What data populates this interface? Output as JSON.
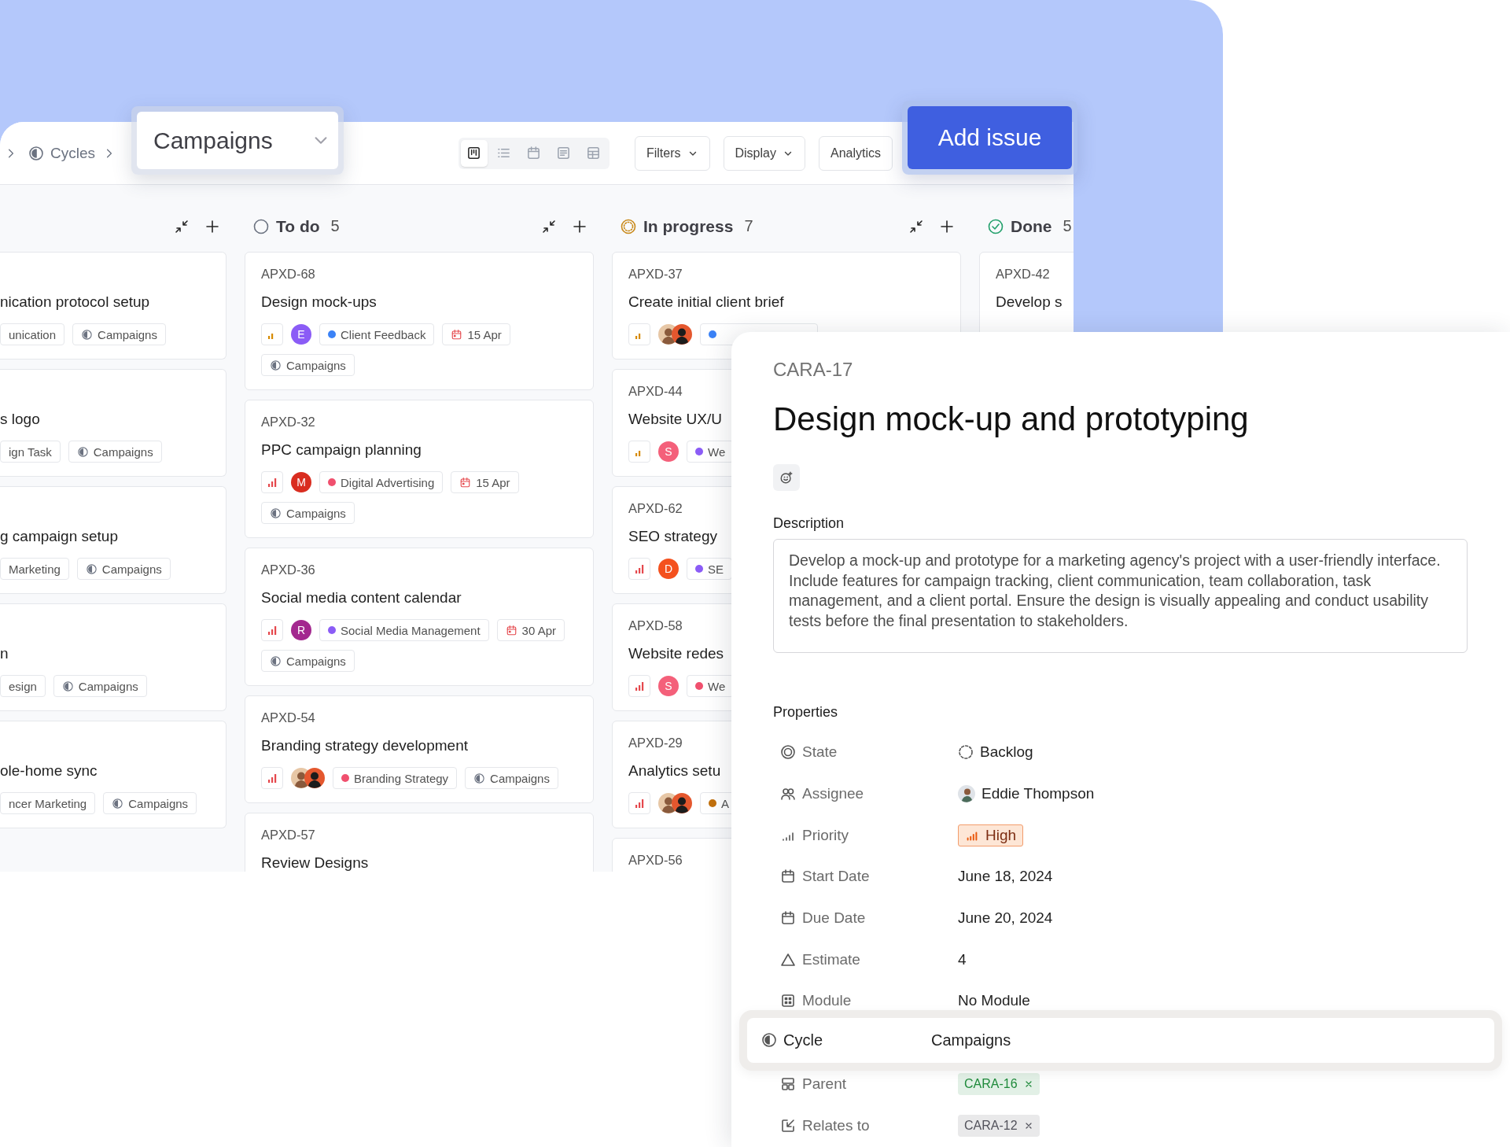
{
  "breadcrumb": {
    "parent": "Cycles",
    "current": "Campaigns"
  },
  "views": [
    {
      "kind": "board",
      "selected": true
    },
    {
      "kind": "list",
      "selected": false
    },
    {
      "kind": "calendar",
      "selected": false
    },
    {
      "kind": "page",
      "selected": false
    },
    {
      "kind": "table",
      "selected": false
    }
  ],
  "toolbar": {
    "filters": "Filters",
    "display": "Display",
    "analytics": "Analytics",
    "add_issue": "Add issue"
  },
  "columns": [
    {
      "cards": [
        {
          "title": "nication protocol setup",
          "label": {
            "text": "unication"
          },
          "cycle": "Campaigns"
        },
        {
          "title": "s logo",
          "label": {
            "text": "ign Task"
          },
          "cycle": "Campaigns"
        },
        {
          "title": "g campaign setup",
          "label": {
            "text": "Marketing"
          },
          "cycle": "Campaigns"
        },
        {
          "title": "n",
          "label": {
            "text": "esign"
          },
          "cycle": "Campaigns"
        },
        {
          "title": "ole-home sync",
          "label": {
            "text": "ncer Marketing"
          },
          "cycle": "Campaigns"
        }
      ]
    },
    {
      "kind": "todo",
      "title": "To do",
      "count": "5",
      "cards": [
        {
          "id": "APXD-68",
          "title": "Design mock-ups",
          "priority": {
            "kind": "medium"
          },
          "avatars": [
            {
              "kind": "letter",
              "letter": "E",
              "color": "#8b5cf6"
            }
          ],
          "label": {
            "text": "Client Feedback",
            "color": "#3b82f6"
          },
          "date": "15 Apr",
          "cycle": "Campaigns"
        },
        {
          "id": "APXD-32",
          "title": "PPC campaign planning",
          "priority": {
            "kind": "high"
          },
          "avatars": [
            {
              "kind": "letter",
              "letter": "M",
              "color": "#d92d20"
            }
          ],
          "label": {
            "text": "Digital Advertising",
            "color": "#f0506e"
          },
          "date": "15 Apr",
          "cycle": "Campaigns"
        },
        {
          "id": "APXD-36",
          "title": "Social media content calendar",
          "priority": {
            "kind": "high"
          },
          "avatars": [
            {
              "kind": "letter",
              "letter": "R",
              "color": "#a3288f"
            }
          ],
          "label": {
            "text": "Social Media Management",
            "color": "#8b5cf6"
          },
          "date": "30 Apr",
          "cycle": "Campaigns"
        },
        {
          "id": "APXD-54",
          "title": "Branding strategy development",
          "priority": {
            "kind": "high"
          },
          "avatars": [
            {
              "kind": "photo"
            },
            {
              "kind": "photo"
            }
          ],
          "label": {
            "text": "Branding Strategy",
            "color": "#f0506e"
          },
          "cycle": "Campaigns"
        },
        {
          "id": "APXD-57",
          "title": "Review Designs"
        }
      ]
    },
    {
      "kind": "in_progress",
      "title": "In progress",
      "count": "7",
      "cards": [
        {
          "id": "APXD-37",
          "title": "Create initial client brief",
          "priority": {
            "kind": "medium"
          },
          "avatars": [
            {
              "kind": "photo"
            },
            {
              "kind": "photo"
            }
          ],
          "label": {
            "color": "#3b82f6"
          }
        },
        {
          "id": "APXD-44",
          "title": "Website UX/U",
          "priority": {
            "kind": "medium"
          },
          "avatars": [
            {
              "kind": "letter",
              "letter": "S",
              "color": "#f4607a"
            }
          ],
          "label": {
            "text": "We",
            "color": "#8b5cf6"
          }
        },
        {
          "id": "APXD-62",
          "title": "SEO strategy",
          "priority": {
            "kind": "high"
          },
          "avatars": [
            {
              "kind": "letter",
              "letter": "D",
              "color": "#f4511e"
            }
          ],
          "label": {
            "text": "SE",
            "color": "#8b5cf6"
          }
        },
        {
          "id": "APXD-58",
          "title": "Website redes",
          "priority": {
            "kind": "high"
          },
          "avatars": [
            {
              "kind": "letter",
              "letter": "S",
              "color": "#f4607a"
            }
          ],
          "label": {
            "text": "We",
            "color": "#f0506e"
          }
        },
        {
          "id": "APXD-29",
          "title": "Analytics setu",
          "priority": {
            "kind": "high"
          },
          "avatars": [
            {
              "kind": "photo"
            },
            {
              "kind": "photo"
            }
          ],
          "label": {
            "text": "A",
            "color": "#c2700c"
          }
        },
        {
          "id": "APXD-56"
        }
      ]
    },
    {
      "kind": "done",
      "title": "Done",
      "count": "5",
      "cards": [
        {
          "id": "APXD-42",
          "title": "Develop s"
        }
      ]
    }
  ],
  "detail": {
    "key": "CARA-17",
    "title": "Design mock-up and prototyping",
    "description_label": "Description",
    "description": "Develop a mock-up and prototype for a marketing agency's project with a user-friendly interface. Include features for campaign tracking, client communication, team collaboration, task management, and a client portal. Ensure the design is visually appealing and conduct usability tests before the final presentation to stakeholders.",
    "properties_label": "Properties",
    "properties": [
      {
        "kind": "state",
        "label": "State",
        "value": "Backlog",
        "highlighted": false
      },
      {
        "kind": "assignee",
        "label": "Assignee",
        "value": "Eddie Thompson",
        "highlighted": false
      },
      {
        "kind": "priority",
        "label": "Priority",
        "value": "High",
        "highlighted": false
      },
      {
        "kind": "date",
        "label": "Start Date",
        "value": "June 18, 2024",
        "highlighted": false
      },
      {
        "kind": "date",
        "label": "Due Date",
        "value": "June 20, 2024",
        "highlighted": false
      },
      {
        "kind": "estimate",
        "label": "Estimate",
        "value": "4",
        "highlighted": false
      },
      {
        "kind": "module",
        "label": "Module",
        "value": "No Module",
        "highlighted": false
      },
      {
        "kind": "cycle",
        "label": "Cycle",
        "value": "Campaigns",
        "highlighted": true
      },
      {
        "kind": "parent",
        "label": "Parent",
        "value": "CARA-16",
        "color": "#1f8a3b",
        "highlighted": false
      },
      {
        "kind": "relation",
        "label": "Relates to",
        "value": "CARA-12",
        "color": "#52525b",
        "highlighted": false
      }
    ]
  }
}
